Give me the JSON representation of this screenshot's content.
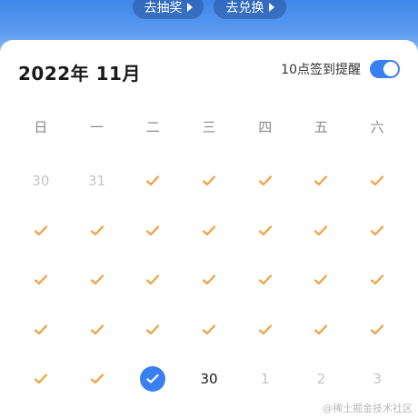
{
  "banner": {
    "lottery_label": "去抽奖",
    "exchange_label": "去兑换"
  },
  "calendar": {
    "month_title": "2022年 11月",
    "reminder_label": "10点签到提醒",
    "reminder_enabled": true,
    "weekdays": [
      "日",
      "一",
      "二",
      "三",
      "四",
      "五",
      "六"
    ],
    "days": [
      {
        "label": "30",
        "state": "muted"
      },
      {
        "label": "31",
        "state": "muted"
      },
      {
        "label": "",
        "state": "checked"
      },
      {
        "label": "",
        "state": "checked"
      },
      {
        "label": "",
        "state": "checked"
      },
      {
        "label": "",
        "state": "checked"
      },
      {
        "label": "",
        "state": "checked"
      },
      {
        "label": "",
        "state": "checked"
      },
      {
        "label": "",
        "state": "checked"
      },
      {
        "label": "",
        "state": "checked"
      },
      {
        "label": "",
        "state": "checked"
      },
      {
        "label": "",
        "state": "checked"
      },
      {
        "label": "",
        "state": "checked"
      },
      {
        "label": "",
        "state": "checked"
      },
      {
        "label": "",
        "state": "checked"
      },
      {
        "label": "",
        "state": "checked"
      },
      {
        "label": "",
        "state": "checked"
      },
      {
        "label": "",
        "state": "checked"
      },
      {
        "label": "",
        "state": "checked"
      },
      {
        "label": "",
        "state": "checked"
      },
      {
        "label": "",
        "state": "checked"
      },
      {
        "label": "",
        "state": "checked"
      },
      {
        "label": "",
        "state": "checked"
      },
      {
        "label": "",
        "state": "checked"
      },
      {
        "label": "",
        "state": "checked"
      },
      {
        "label": "",
        "state": "checked"
      },
      {
        "label": "",
        "state": "checked"
      },
      {
        "label": "",
        "state": "checked"
      },
      {
        "label": "",
        "state": "checked"
      },
      {
        "label": "",
        "state": "checked"
      },
      {
        "label": "",
        "state": "today"
      },
      {
        "label": "30",
        "state": "normal"
      },
      {
        "label": "1",
        "state": "muted"
      },
      {
        "label": "2",
        "state": "muted"
      },
      {
        "label": "3",
        "state": "muted"
      }
    ]
  },
  "watermark": "@稀土掘金技术社区",
  "colors": {
    "accent": "#3a7ff0",
    "check": "#f0a040",
    "muted_text": "#c4c4c4"
  },
  "icons": {
    "checked": "checkmark-icon",
    "today": "check-circle-icon",
    "banner_arrow": "triangle-right-icon"
  }
}
